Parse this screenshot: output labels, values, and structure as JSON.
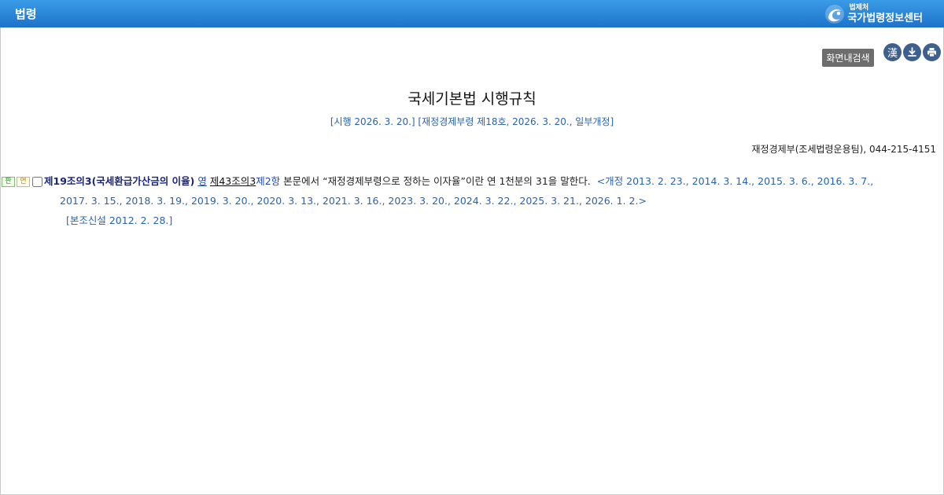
{
  "header": {
    "title": "법령",
    "logo_sub": "법제처",
    "logo_main": "국가법령정보센터"
  },
  "toolbar": {
    "search_label": "화면내검색",
    "hanja_label": "漢",
    "download_icon": "download-icon",
    "print_icon": "print-icon"
  },
  "law": {
    "title": "국세기본법 시행규칙",
    "subtitle": "[시행 2026. 3. 20.] [재정경제부령 제18호, 2026. 3. 20., 일부개정]",
    "ministry": "재정경제부(조세법령운용팀), 044-215-4151"
  },
  "article": {
    "badge_pan": "판",
    "badge_yeon": "연",
    "title": "제19조의3(국세환급가산금의 이율)",
    "link_yeong": "영",
    "link_article": "제43조의3",
    "link_paragraph": "제2항",
    "body": " 본문에서 “재정경제부령으로 정하는 이자율”이란 연 1천분의 31을 말한다.",
    "amendments_line1": "<개정 2013. 2. 23., 2014. 3. 14., 2015. 3. 6., 2016. 3. 7.,",
    "amendments_line2": "2017. 3. 15., 2018. 3. 19., 2019. 3. 20., 2020. 3. 13., 2021. 3. 16., 2023. 3. 20., 2024. 3. 22., 2025. 3. 21., 2026. 1. 2.>",
    "new_article": "[본조신설 2012. 2. 28.]"
  },
  "colors": {
    "header_top": "#3a9be6",
    "header_bottom": "#1d73c9",
    "article_title": "#1a237e",
    "amendment_blue": "#2a63ad",
    "toolbar_icon": "#3f5f8e"
  }
}
